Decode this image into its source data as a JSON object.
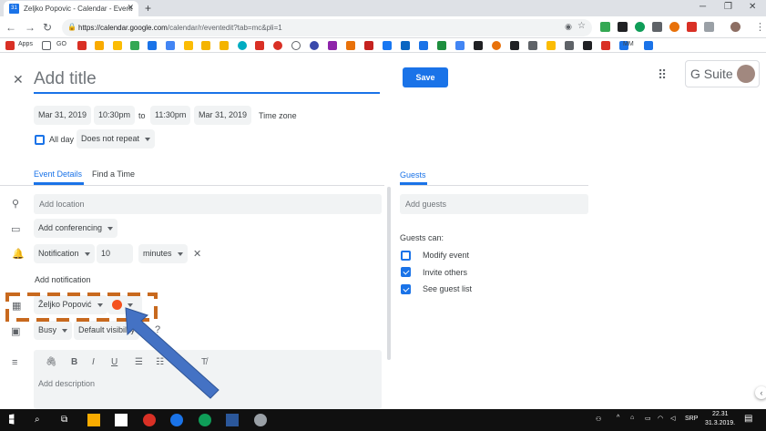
{
  "browser": {
    "tab_title": "Zeljko Popovic - Calendar - Event",
    "tab_favicon": "31",
    "url_prefix": "https://calendar.google.com",
    "url_rest": "/calendar/r/eventedit?tab=mc&pli=1",
    "bookmarks": {
      "apps": "Apps",
      "go": "GO",
      "mm": "MM"
    }
  },
  "event": {
    "title_placeholder": "Add title",
    "save_label": "Save",
    "start_date": "Mar 31, 2019",
    "start_time": "10:30pm",
    "to_label": "to",
    "end_time": "11:30pm",
    "end_date": "Mar 31, 2019",
    "timezone_label": "Time zone",
    "all_day_label": "All day",
    "repeat_label": "Does not repeat",
    "brand": "G Suite"
  },
  "tabs": {
    "details": "Event Details",
    "find_time": "Find a Time"
  },
  "details": {
    "location_placeholder": "Add location",
    "conferencing_label": "Add conferencing",
    "notification_type": "Notification",
    "notification_value": "10",
    "notification_unit": "minutes",
    "add_notification": "Add notification",
    "calendar_owner": "Željko Popović",
    "event_color": "#f4511e",
    "status": "Busy",
    "visibility": "Default visibility",
    "description_placeholder": "Add description"
  },
  "guests": {
    "heading": "Guests",
    "add_placeholder": "Add guests",
    "can_label": "Guests can:",
    "options": [
      {
        "label": "Modify event",
        "checked": false
      },
      {
        "label": "Invite others",
        "checked": true
      },
      {
        "label": "See guest list",
        "checked": true
      }
    ]
  },
  "taskbar": {
    "language": "SRP",
    "time": "22.31",
    "date": "31.3.2019."
  },
  "colors": {
    "accent": "#1a73e8",
    "annotation_orange": "#c8691e",
    "annotation_arrow": "#4472c4"
  }
}
